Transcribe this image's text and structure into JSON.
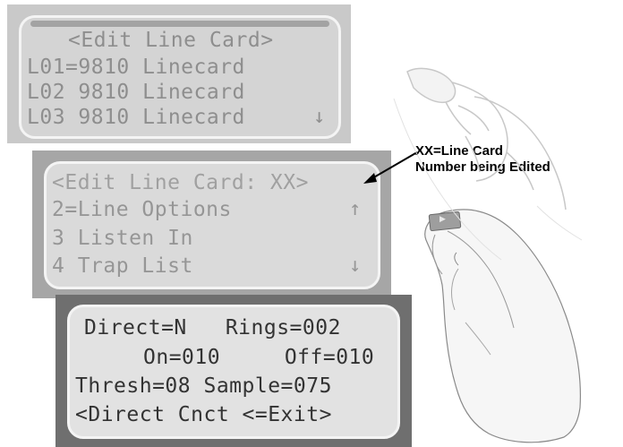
{
  "panels": [
    {
      "lines": [
        "<Edit Line Card>",
        "L01=9810 Linecard",
        "L02 9810 Linecard",
        "L03 9810 Linecard"
      ],
      "scroll_down": "↓"
    },
    {
      "lines": [
        "<Edit Line Card: XX>",
        "2=Line Options",
        "3 Listen In",
        "4 Trap List"
      ],
      "scroll_up": "↑",
      "scroll_down": "↓"
    },
    {
      "lines": [
        "Direct=N   Rings=002",
        "On=010     Off=010",
        "Thresh=08 Sample=075",
        "<Direct Cnct <=Exit>"
      ]
    }
  ],
  "callout": {
    "line1": "XX=Line Card",
    "line2": "Number being Edited"
  },
  "card_label": "▶"
}
